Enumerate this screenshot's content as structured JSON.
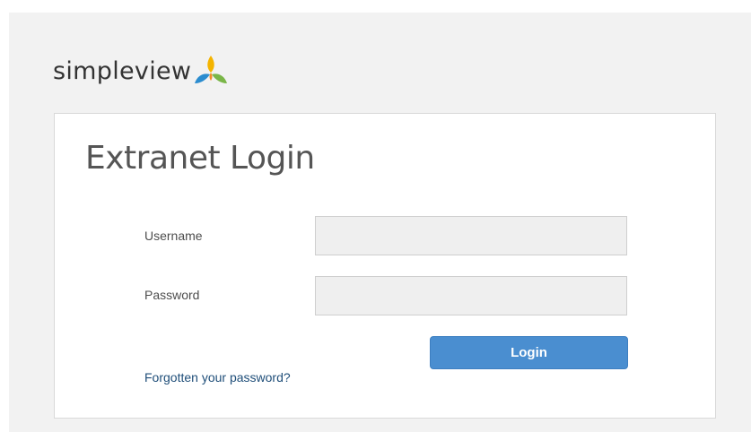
{
  "brand": {
    "name": "simpleview",
    "logo_icon": "simpleview-leaf-mark-icon",
    "colors": {
      "yellow": "#f4b400",
      "orange": "#f28c28",
      "blue": "#2b8ccf",
      "green": "#7ab648"
    }
  },
  "login": {
    "title": "Extranet Login",
    "username": {
      "label": "Username",
      "value": "",
      "placeholder": ""
    },
    "password": {
      "label": "Password",
      "value": "",
      "placeholder": ""
    },
    "submit_label": "Login",
    "forgot_label": "Forgotten your password?",
    "button_color": "#4a8ed0",
    "link_color": "#1f4e79"
  }
}
